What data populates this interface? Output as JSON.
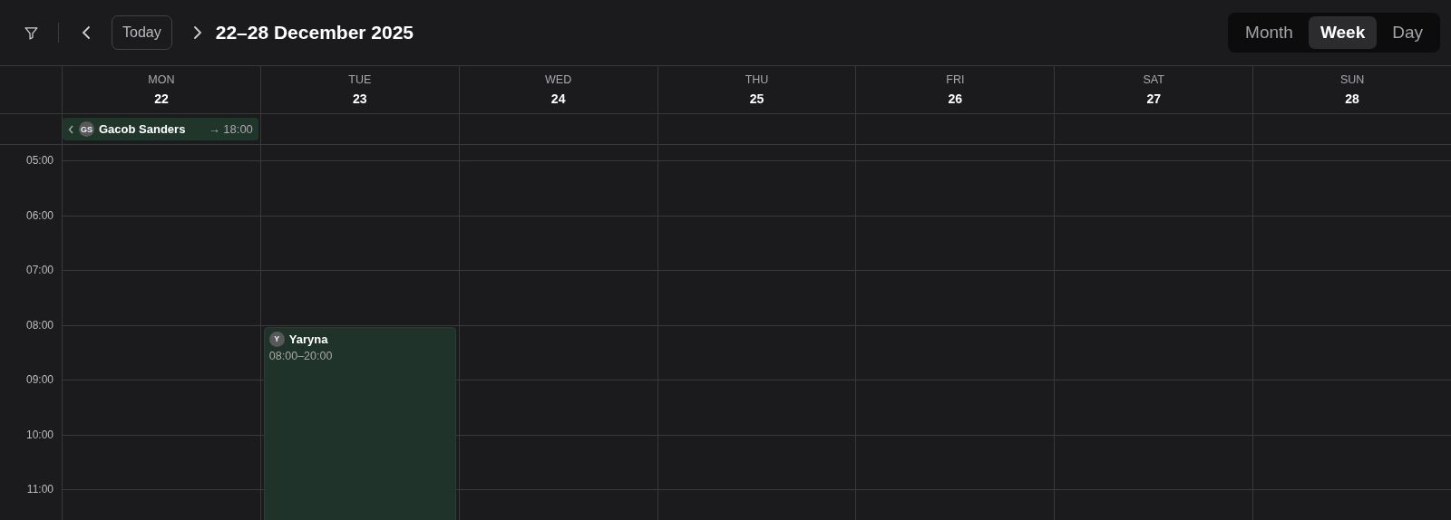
{
  "toolbar": {
    "today_button": "Today",
    "range_title": "22–28 December 2025"
  },
  "views": [
    {
      "label": "Month",
      "selected": false
    },
    {
      "label": "Week",
      "selected": true
    },
    {
      "label": "Day",
      "selected": false
    }
  ],
  "days": [
    {
      "weekday": "MON",
      "date": "22",
      "all_day": [
        {
          "initials": "GS",
          "name": "Gacob Sanders",
          "end": "→ 18:00",
          "continues_before": true
        }
      ]
    },
    {
      "weekday": "TUE",
      "date": "23",
      "events": [
        {
          "initials": "Y",
          "name": "Yaryna",
          "time": "08:00–20:00"
        }
      ]
    },
    {
      "weekday": "WED",
      "date": "24"
    },
    {
      "weekday": "THU",
      "date": "25"
    },
    {
      "weekday": "FRI",
      "date": "26"
    },
    {
      "weekday": "SAT",
      "date": "27"
    },
    {
      "weekday": "SUN",
      "date": "28"
    }
  ],
  "hours": [
    "05:00",
    "06:00",
    "07:00",
    "08:00",
    "09:00",
    "10:00",
    "11:00"
  ]
}
